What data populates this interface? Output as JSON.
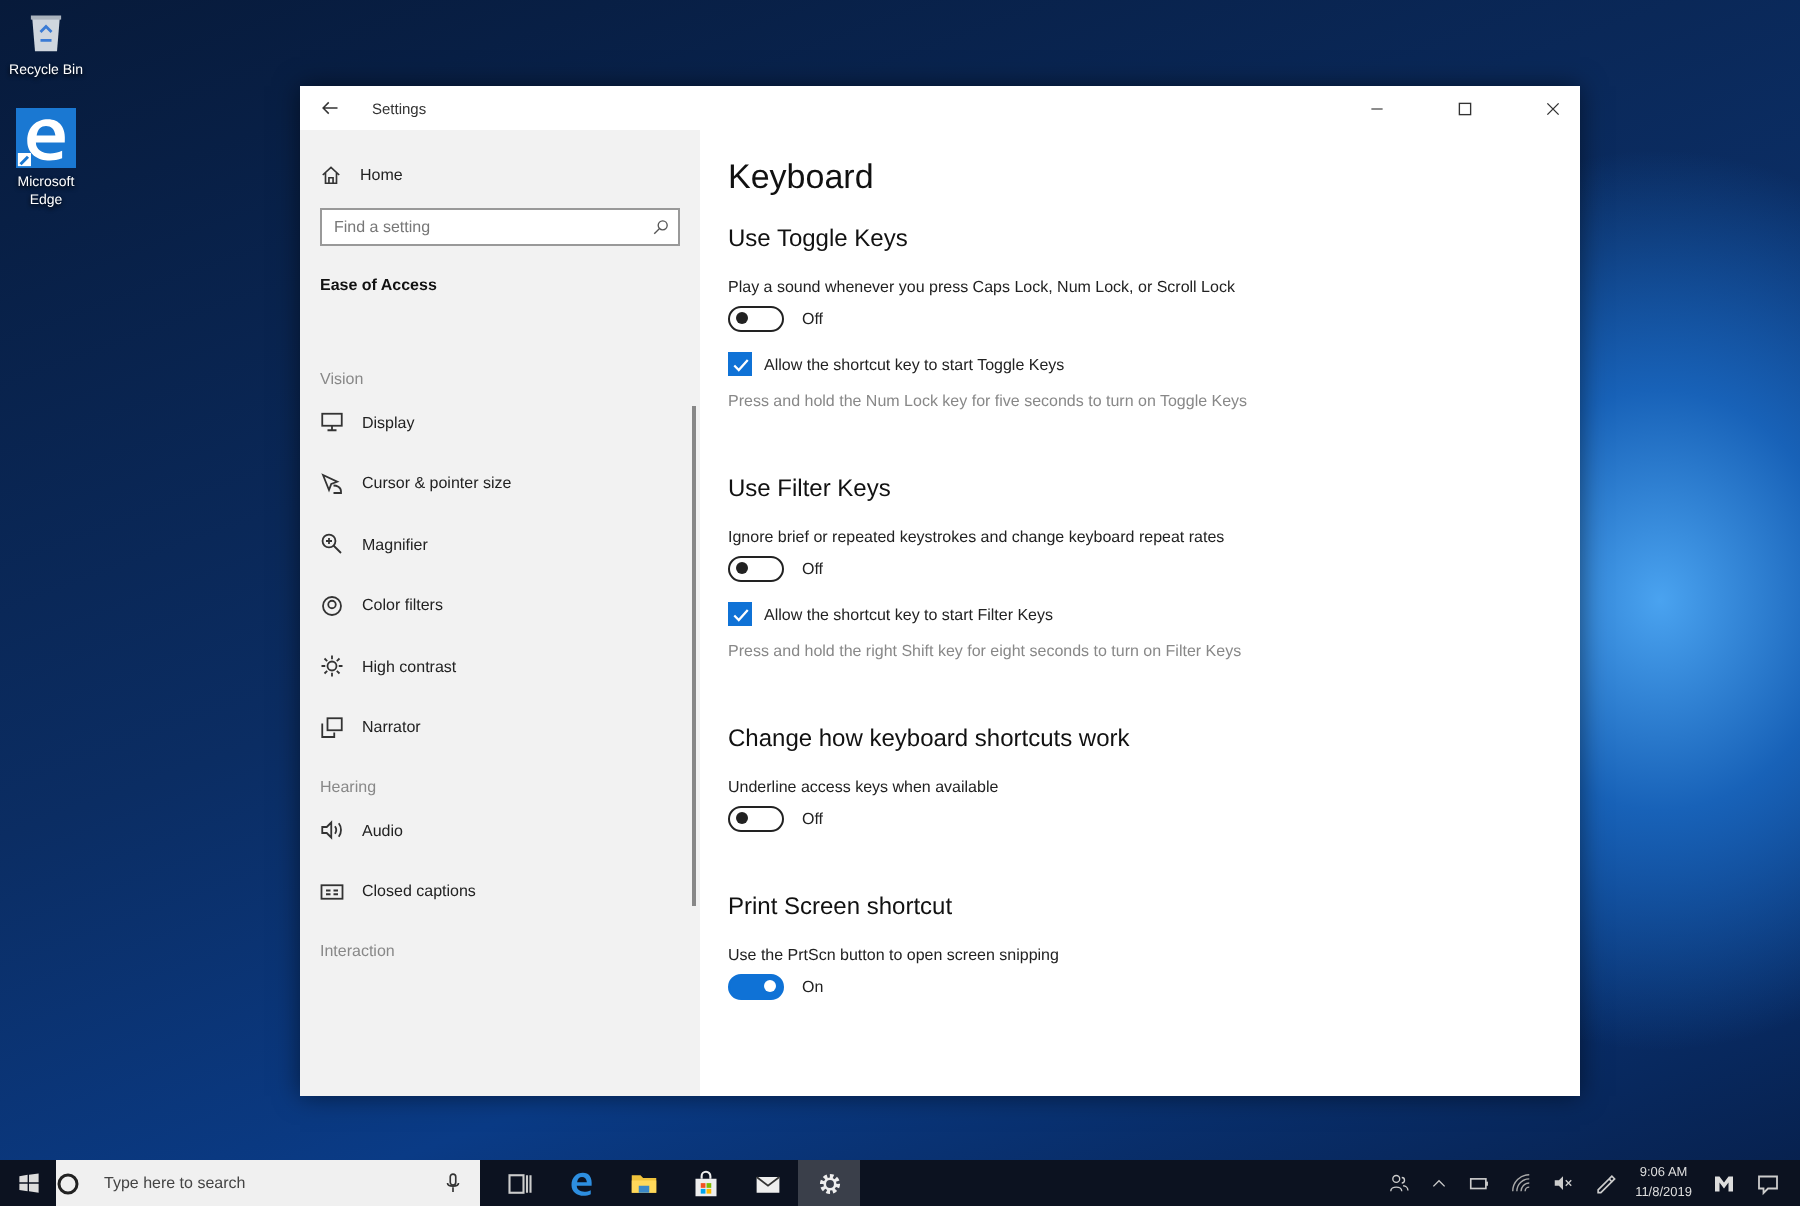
{
  "desktop_icons": [
    {
      "kind": "bin",
      "label": "Recycle Bin"
    },
    {
      "kind": "edge",
      "label": "Microsoft Edge"
    }
  ],
  "window": {
    "title": "Settings"
  },
  "sidebar": {
    "home": "Home",
    "search": {
      "placeholder": "Find a setting"
    },
    "category": "Ease of Access",
    "groups": [
      {
        "heading": "Vision",
        "items": [
          {
            "kind": "display",
            "label": "Display"
          },
          {
            "kind": "cursor",
            "label": "Cursor & pointer size"
          },
          {
            "kind": "magnifier",
            "label": "Magnifier"
          },
          {
            "kind": "filters",
            "label": "Color filters"
          },
          {
            "kind": "contrast",
            "label": "High contrast"
          },
          {
            "kind": "narrator",
            "label": "Narrator"
          }
        ]
      },
      {
        "heading": "Hearing",
        "items": [
          {
            "kind": "audio",
            "label": "Audio"
          },
          {
            "kind": "captions",
            "label": "Closed captions"
          }
        ]
      },
      {
        "heading": "Interaction"
      }
    ]
  },
  "main": {
    "title": "Keyboard",
    "sections": [
      {
        "heading": "Use Toggle Keys",
        "controls": [
          {
            "kind": "toggle",
            "label": "Play a sound whenever you press Caps Lock, Num Lock, or Scroll Lock",
            "on": false,
            "state": "Off"
          },
          {
            "kind": "checkbox",
            "label": "Allow the shortcut key to start Toggle Keys",
            "checked": true,
            "description": "Press and hold the Num Lock key for five seconds to turn on Toggle Keys"
          }
        ]
      },
      {
        "heading": "Use Filter Keys",
        "controls": [
          {
            "kind": "toggle",
            "label": "Ignore brief or repeated keystrokes and change keyboard repeat rates",
            "on": false,
            "state": "Off"
          },
          {
            "kind": "checkbox",
            "label": "Allow the shortcut key to start Filter Keys",
            "checked": true,
            "description": "Press and hold the right Shift key for eight seconds to turn on Filter Keys"
          }
        ]
      },
      {
        "heading": "Change how keyboard shortcuts work",
        "controls": [
          {
            "kind": "toggle",
            "label": "Underline access keys when available",
            "on": false,
            "state": "Off"
          }
        ]
      },
      {
        "heading": "Print Screen shortcut",
        "controls": [
          {
            "kind": "toggle",
            "label": "Use the PrtScn button to open screen snipping",
            "on": true,
            "state": "On"
          }
        ]
      }
    ]
  },
  "taskbar": {
    "search": {
      "placeholder": "Type here to search"
    },
    "apps": [
      {
        "kind": "task-view",
        "selected": false
      },
      {
        "kind": "edge",
        "selected": false
      },
      {
        "kind": "folder",
        "selected": false
      },
      {
        "kind": "store",
        "selected": false
      },
      {
        "kind": "mail",
        "selected": false
      },
      {
        "kind": "gear",
        "selected": true
      }
    ],
    "time": "9:06 AM",
    "date": "11/8/2019"
  }
}
